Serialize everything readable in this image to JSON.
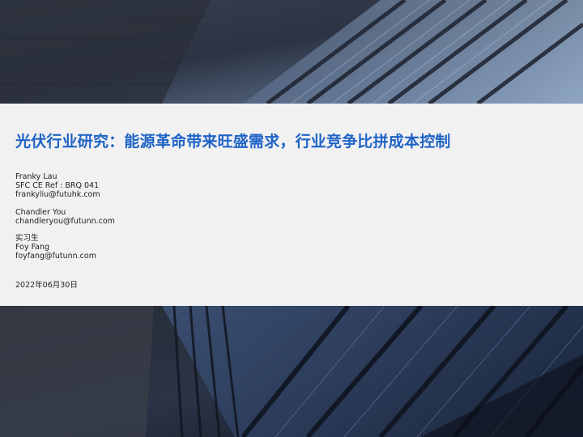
{
  "title": "光伏行业研究：能源革命带来旺盛需求，行业竞争比拼成本控制",
  "authors": [
    {
      "name": "Franky Lau",
      "credential": "SFC CE Ref : BRQ 041",
      "email": "frankyliu@futuhk.com"
    },
    {
      "name": "Chandler You",
      "email": "chandleryou@futunn.com"
    },
    {
      "role": "实习生",
      "name": "Foy Fang",
      "email": "foyfang@futunn.com"
    }
  ],
  "date": "2022年06月30日",
  "colors": {
    "title": "#1f63c6",
    "band": "#f1f1f2",
    "text": "#222222",
    "background_dark": "#1b2230"
  },
  "background": "skyscraper-photo"
}
